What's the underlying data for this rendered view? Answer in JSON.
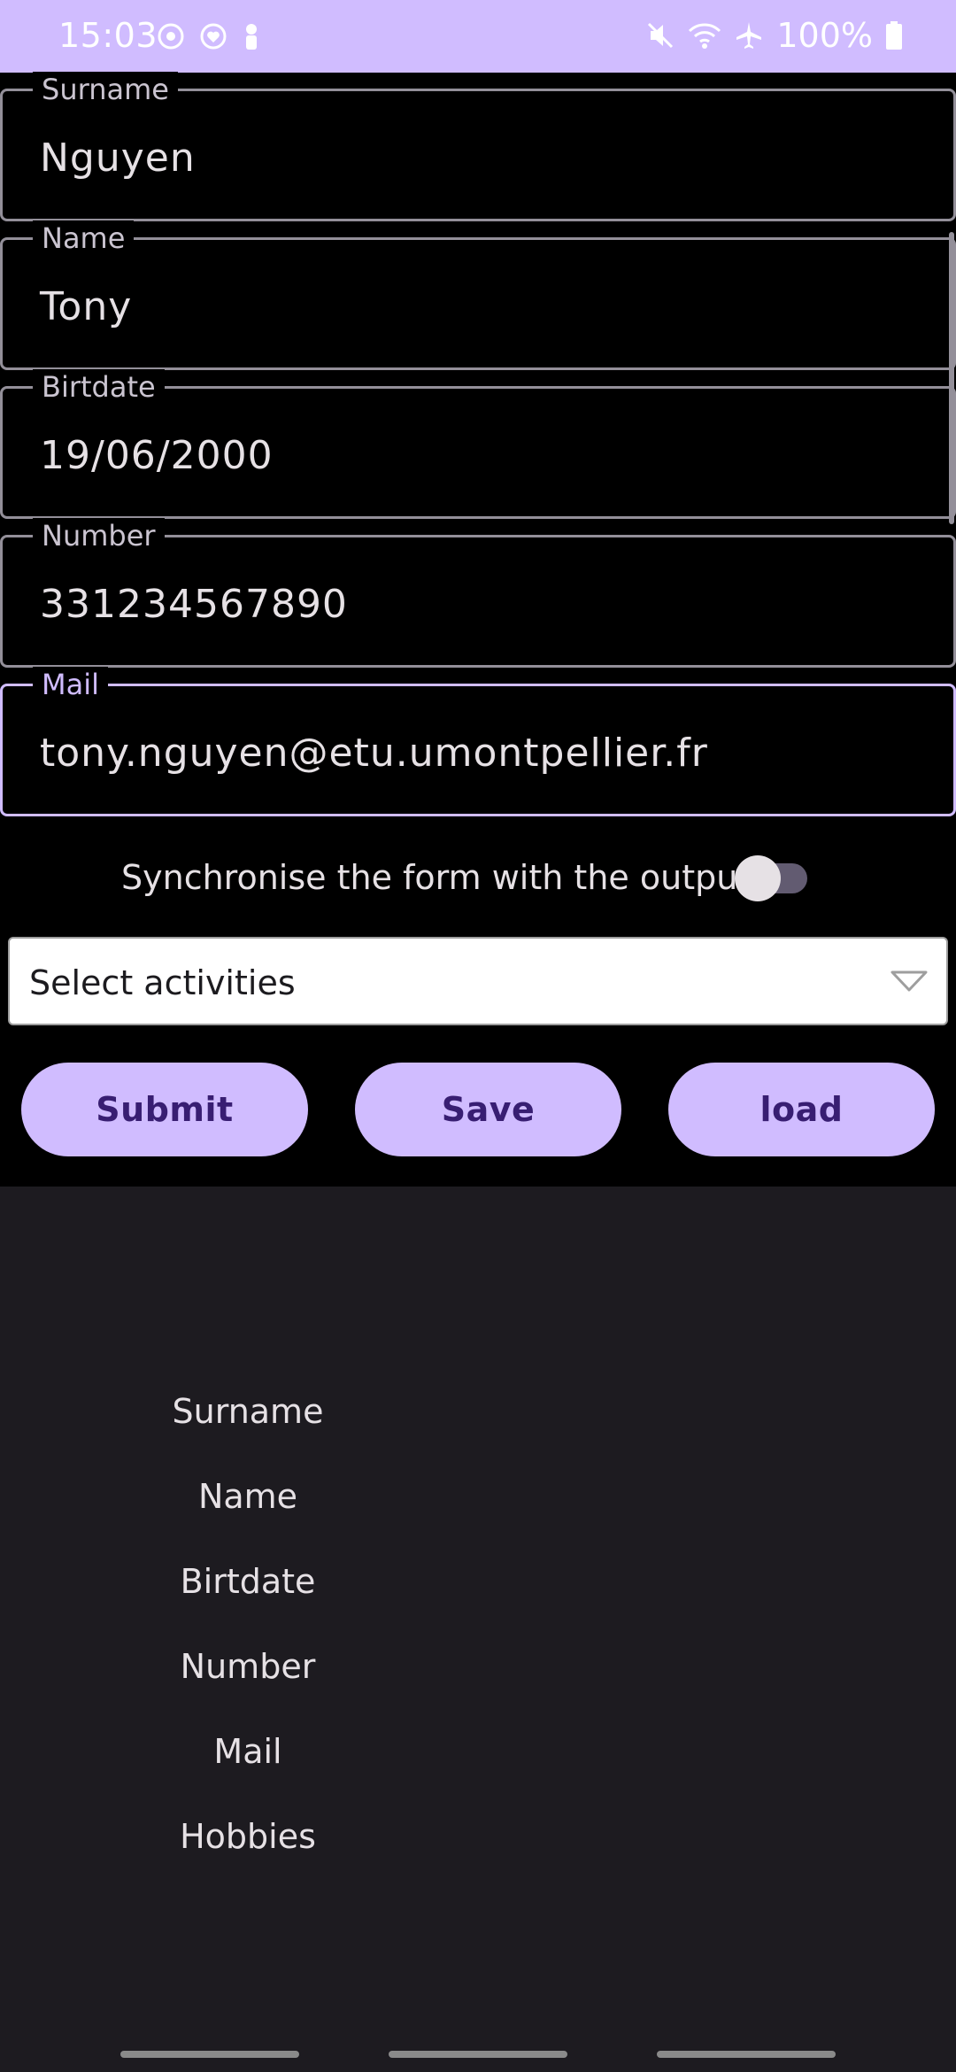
{
  "status_bar": {
    "time": "15:03",
    "left_icons": [
      "sync-icon",
      "heart-sync-icon",
      "notification-icon"
    ],
    "right_icons": [
      "mute-icon",
      "wifi-icon",
      "airplane-icon",
      "battery-icon"
    ],
    "battery": "100%"
  },
  "form": {
    "surname": {
      "label": "Surname",
      "value": "Nguyen"
    },
    "name": {
      "label": "Name",
      "value": "Tony"
    },
    "birthdate": {
      "label": "Birtdate",
      "value": "19/06/2000"
    },
    "number": {
      "label": "Number",
      "value": "331234567890"
    },
    "mail": {
      "label": "Mail",
      "value": "tony.nguyen@etu.umontpellier.fr"
    }
  },
  "sync": {
    "label": "Synchronise the form with the output",
    "enabled": false
  },
  "activities": {
    "placeholder": "Select activities"
  },
  "buttons": {
    "submit": "Submit",
    "save": "Save",
    "load": "load"
  },
  "output": {
    "labels": [
      "Surname",
      "Name",
      "Birtdate",
      "Number",
      "Mail",
      "Hobbies"
    ]
  },
  "colors": {
    "accent": "#d0bcff",
    "on_accent": "#381e72",
    "output_bg": "#1d1b20",
    "field_border": "#938f99"
  }
}
